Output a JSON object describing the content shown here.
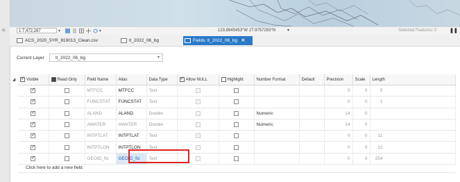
{
  "map": {
    "coordinates": "123.8945453°W 27.9757293°N"
  },
  "statusbar": {
    "scale": "1:7,472,287",
    "selected_features": "Selected Features: 0"
  },
  "tabs": [
    {
      "label": "ACS_2020_5YR_819013_Clean.csv",
      "active": false,
      "closable": false,
      "icon": "table-icon"
    },
    {
      "label": "tl_2022_06_bg",
      "active": false,
      "closable": false,
      "icon": "table-icon"
    },
    {
      "label": "Fields: tl_2022_06_bg",
      "active": true,
      "closable": true,
      "icon": "fields-icon"
    }
  ],
  "current_layer": {
    "label": "Current Layer",
    "value": "tl_2022_06_bg"
  },
  "columns": {
    "visible": "Visible",
    "read_only": "Read Only",
    "field_name": "Field Name",
    "alias": "Alias",
    "data_type": "Data Type",
    "allow_null": "Allow NULL",
    "highlight": "Highlight",
    "number_format": "Number Format",
    "default": "Default",
    "precision": "Precision",
    "scale": "Scale",
    "length": "Length"
  },
  "rows": [
    {
      "field_name": "MTFCC",
      "alias": "MTFCC",
      "data_type": "Text",
      "number_format": "",
      "precision": "0",
      "scale": "0",
      "length": "5"
    },
    {
      "field_name": "FUNCSTAT",
      "alias": "FUNCSTAT",
      "data_type": "Text",
      "number_format": "",
      "precision": "0",
      "scale": "0",
      "length": "1"
    },
    {
      "field_name": "ALAND",
      "alias": "ALAND",
      "data_type": "Double",
      "number_format": "Numeric",
      "precision": "14",
      "scale": "0",
      "length": ""
    },
    {
      "field_name": "AWATER",
      "alias": "AWATER",
      "data_type": "Double",
      "number_format": "Numeric",
      "precision": "14",
      "scale": "0",
      "length": ""
    },
    {
      "field_name": "INTPTLAT",
      "alias": "INTPTLAT",
      "data_type": "Text",
      "number_format": "",
      "precision": "0",
      "scale": "0",
      "length": "11"
    },
    {
      "field_name": "INTPTLON",
      "alias": "INTPTLON",
      "data_type": "Text",
      "number_format": "",
      "precision": "0",
      "scale": "0",
      "length": "12"
    },
    {
      "field_name": "GEOID_fix",
      "alias": "GEOID_fix",
      "data_type": "Text",
      "number_format": "",
      "precision": "0",
      "scale": "0",
      "length": "254"
    }
  ],
  "add_row": "Click here to add a new field.",
  "colors": {
    "accent": "#2a79c8",
    "callout": "#e02020"
  }
}
